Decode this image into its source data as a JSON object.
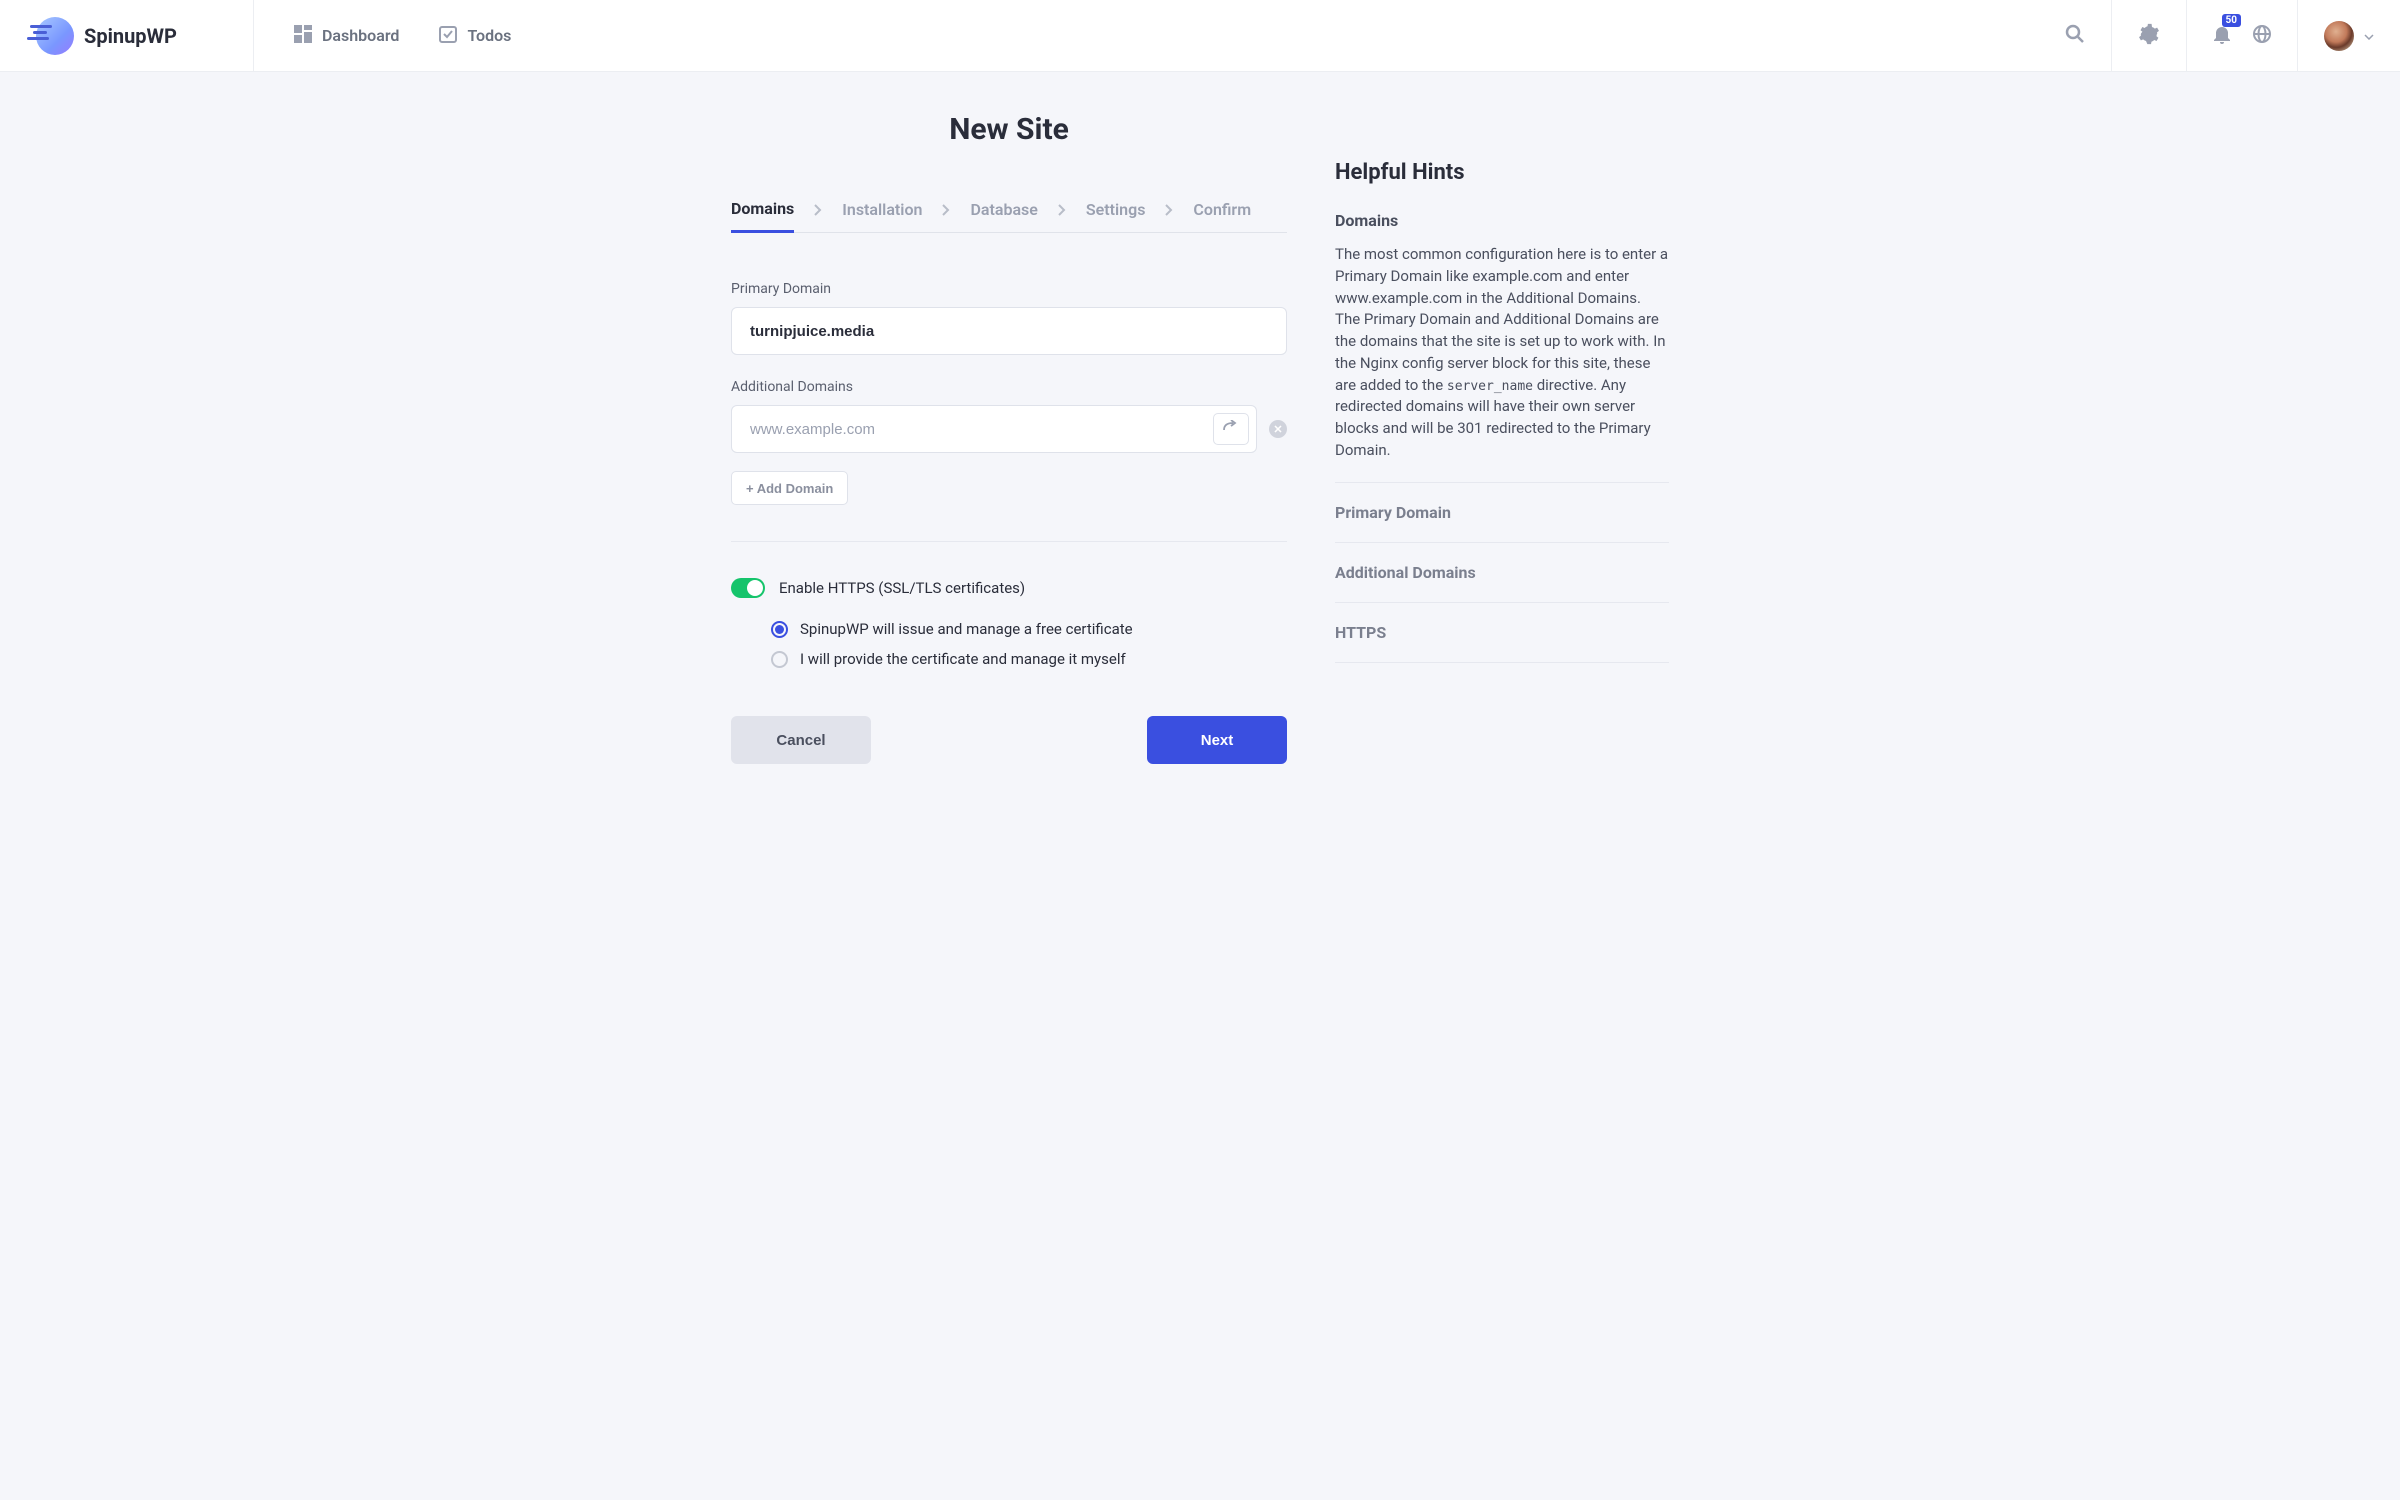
{
  "brand": "SpinupWP",
  "nav": {
    "dashboard": "Dashboard",
    "todos": "Todos"
  },
  "notifications": {
    "count": "50"
  },
  "page": {
    "title": "New Site"
  },
  "wizard": {
    "steps": [
      "Domains",
      "Installation",
      "Database",
      "Settings",
      "Confirm"
    ],
    "active_index": 0
  },
  "form": {
    "primary_label": "Primary Domain",
    "primary_value": "turnipjuice.media",
    "additional_label": "Additional Domains",
    "additional_placeholder": "www.example.com",
    "add_domain_button": "+ Add Domain",
    "https_toggle_label": "Enable HTTPS (SSL/TLS certificates)",
    "https_enabled": true,
    "cert_options": [
      "SpinupWP will issue and manage a free certificate",
      "I will provide the certificate and manage it myself"
    ],
    "cert_selected_index": 0,
    "cancel": "Cancel",
    "next": "Next"
  },
  "hints": {
    "title": "Helpful Hints",
    "domains_title": "Domains",
    "domains_body_pre": "The most common configuration here is to enter a Primary Domain like example.com and enter www.example.com in the Additional Domains. The Primary Domain and Additional Domains are the domains that the site is set up to work with. In the Nginx config server block for this site, these are added to the ",
    "domains_body_code": "server_name",
    "domains_body_post": " directive. Any redirected domains will have their own server blocks and will be 301 redirected to the Primary Domain.",
    "sections": [
      "Primary Domain",
      "Additional Domains",
      "HTTPS"
    ]
  }
}
